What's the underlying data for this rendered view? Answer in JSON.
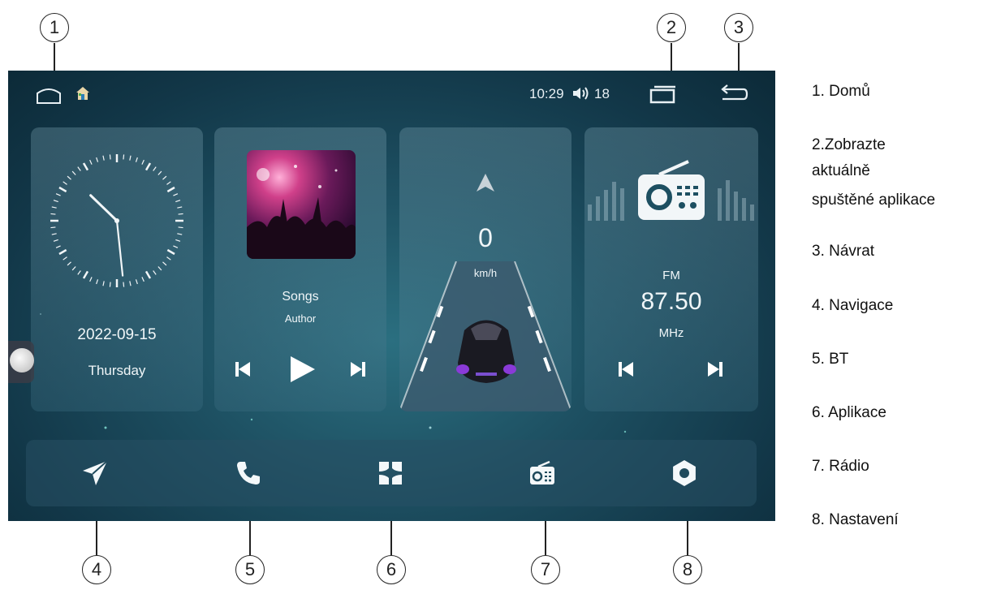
{
  "status_bar": {
    "time": "10:29",
    "volume_icon": "speaker-icon",
    "volume": "18"
  },
  "clock_widget": {
    "date": "2022-09-15",
    "weekday": "Thursday"
  },
  "music_widget": {
    "title": "Songs",
    "author": "Author"
  },
  "nav_widget": {
    "speed": "0",
    "unit": "km/h"
  },
  "radio_widget": {
    "band": "FM",
    "frequency": "87.50",
    "unit": "MHz"
  },
  "dock": {
    "icons": [
      "navigation-icon",
      "phone-icon",
      "apps-icon",
      "radio-icon",
      "settings-icon"
    ]
  },
  "callouts": [
    "1",
    "2",
    "3",
    "4",
    "5",
    "6",
    "7",
    "8"
  ],
  "legend": {
    "item1": "1. Domů",
    "item2_line1": "2.Zobrazte",
    "item2_line2": "aktuálně",
    "item2_line3": "spuštěné aplikace",
    "item3": "3. Návrat",
    "item4": "4. Navigace",
    "item5": "5. BT",
    "item6": "6. Aplikace",
    "item7": "7. Rádio",
    "item8": "8. Nastavení"
  },
  "colors": {
    "screen_bg": "#1d4f61",
    "accent_purple": "#7a4fd0",
    "text": "#f0f6f8"
  }
}
